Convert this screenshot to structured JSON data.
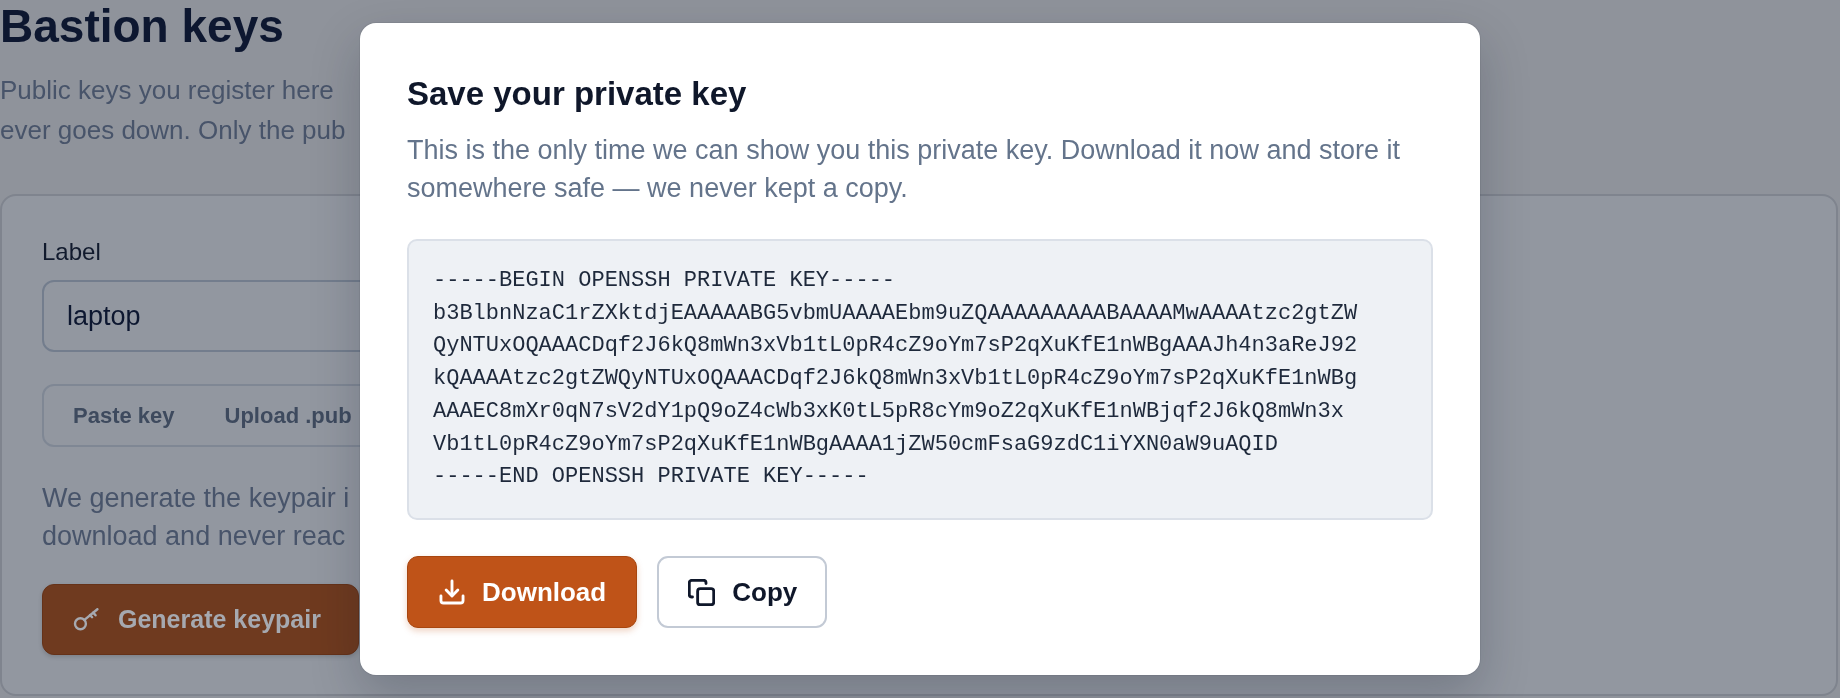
{
  "page": {
    "title": "Bastion keys",
    "description_lines": [
      "Public keys you register here",
      "ever goes down. Only the pub"
    ]
  },
  "form": {
    "label": "Label",
    "label_value": "laptop",
    "tabs": [
      {
        "label": "Paste key",
        "selected": false
      },
      {
        "label": "Upload .pub",
        "selected": false
      }
    ],
    "note_lines": [
      "We generate the keypair i",
      "download and never reac"
    ],
    "generate_button": "Generate keypair"
  },
  "dialog": {
    "title": "Save your private key",
    "description": "This is the only time we can show you this private key. Download it now and store it somewhere safe — we never kept a copy.",
    "private_key": "-----BEGIN OPENSSH PRIVATE KEY-----\nb3BlbnNzaC1rZXktdjEAAAAABG5vbmUAAAAEbm9uZQAAAAAAAAABAAAAMwAAAAtzc2gtZW\nQyNTUxOQAAACDqf2J6kQ8mWn3xVb1tL0pR4cZ9oYm7sP2qXuKfE1nWBgAAAJh4n3aReJ92\nkQAAAAtzc2gtZWQyNTUxOQAAACDqf2J6kQ8mWn3xVb1tL0pR4cZ9oYm7sP2qXuKfE1nWBg\nAAAEC8mXr0qN7sV2dY1pQ9oZ4cWb3xK0tL5pR8cYm9oZ2qXuKfE1nWBjqf2J6kQ8mWn3x\nVb1tL0pR4cZ9oYm7sP2qXuKfE1nWBgAAAA1jZW50cmFsaG9zdC1iYXN0aW9uAQID\n-----END OPENSSH PRIVATE KEY-----",
    "buttons": [
      {
        "label": "Download",
        "kind": "download"
      },
      {
        "label": "Copy",
        "kind": "copy"
      }
    ]
  }
}
